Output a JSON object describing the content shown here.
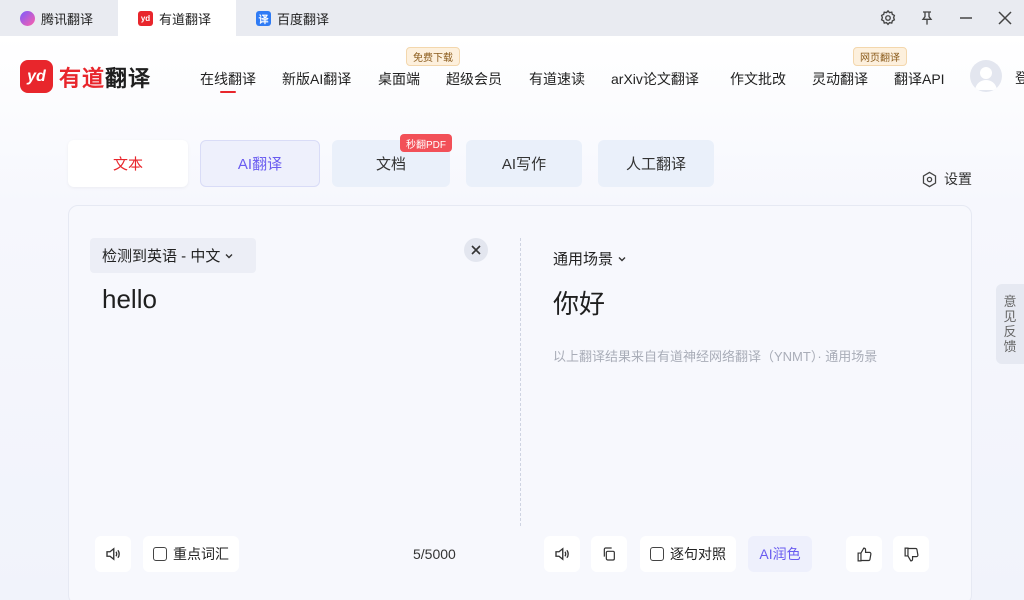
{
  "window_tabs": [
    {
      "label": "腾讯翻译",
      "icon": "tencent-icon"
    },
    {
      "label": "有道翻译",
      "icon": "youdao-icon",
      "active": true
    },
    {
      "label": "百度翻译",
      "icon": "baidu-icon"
    }
  ],
  "logo": {
    "box": "yd",
    "brand": "有道",
    "product": "翻译"
  },
  "nav": {
    "items": [
      "在线翻译",
      "新版AI翻译",
      "桌面端",
      "超级会员",
      "有道速读",
      "arXiv论文翻译",
      "作文批改",
      "灵动翻译",
      "翻译API"
    ],
    "badge_desktop": "免费下载",
    "badge_web": "网页翻译",
    "login": "登"
  },
  "modes": {
    "text": "文本",
    "ai": "AI翻译",
    "doc": "文档",
    "doc_badge": "秒翻PDF",
    "ai_write": "AI写作",
    "human": "人工翻译"
  },
  "settings_label": "设置",
  "source": {
    "language": "检测到英语 - 中文",
    "text": "hello",
    "char_count": "5/5000",
    "key_words_label": "重点词汇"
  },
  "target": {
    "scene": "通用场景",
    "text": "你好",
    "note": "以上翻译结果来自有道神经网络翻译（YNMT）· 通用场景",
    "compare_label": "逐句对照",
    "ai_polish_label": "AI润色"
  },
  "feedback_label": [
    "意",
    "见",
    "反",
    "馈"
  ],
  "colors": {
    "brand_red": "#e8262c",
    "ai_purple": "#6a5cf0"
  }
}
